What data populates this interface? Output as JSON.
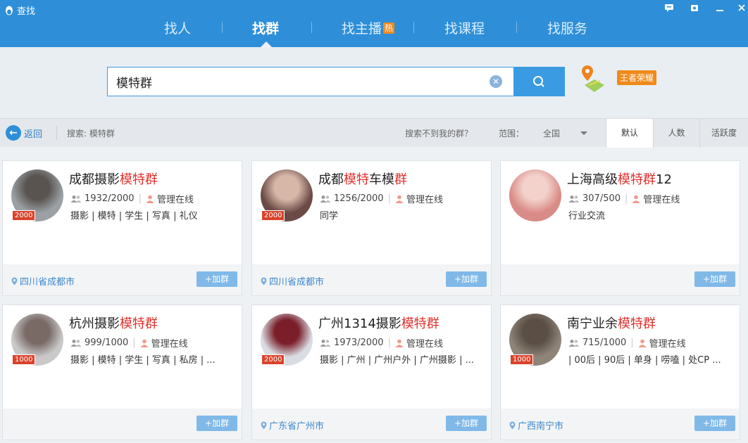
{
  "window": {
    "title": "查找",
    "controls": [
      "feedback-icon",
      "skin-icon",
      "minimize-icon",
      "close-icon"
    ]
  },
  "nav": {
    "items": [
      {
        "label": "找人"
      },
      {
        "label": "找群"
      },
      {
        "label": "找主播",
        "badge": "热"
      },
      {
        "label": "找课程"
      },
      {
        "label": "找服务"
      }
    ],
    "active_index": 1
  },
  "search": {
    "value": "模特群",
    "location_badge": "王者荣耀"
  },
  "toolbar": {
    "back_label": "返回",
    "crumb": "搜索: 模特群",
    "cant_find": "搜索不到我的群？",
    "range_label": "范围：",
    "range_value": "全国",
    "sort_tabs": [
      "默认",
      "人数",
      "活跃度"
    ],
    "active_sort": 0
  },
  "cards": [
    {
      "name_pre": "成都摄影",
      "name_hl": "模特群",
      "name_post": "",
      "members": "1932/2000",
      "admin": "管理在线",
      "tags": "摄影 | 模特 | 学生 | 写真 | 礼仪",
      "location": "四川省成都市",
      "cap": "2000",
      "join": "+加群"
    },
    {
      "name_pre": "成都",
      "name_hl": "模特",
      "name_mid": "车模",
      "name_hl2": "群",
      "name_post": "",
      "members": "1256/2000",
      "admin": "管理在线",
      "tags": "同学",
      "location": "四川省成都市",
      "cap": "2000",
      "join": "+加群"
    },
    {
      "name_pre": "上海高级",
      "name_hl": "模特群",
      "name_post": "12",
      "members": "307/500",
      "admin": "管理在线",
      "tags": "行业交流",
      "location": "",
      "cap": "",
      "join": "+加群"
    },
    {
      "name_pre": "杭州摄影",
      "name_hl": "模特群",
      "name_post": "",
      "members": "999/1000",
      "admin": "管理在线",
      "tags": "摄影 | 模特 | 学生 | 写真 | 私房 | ...",
      "location": "",
      "cap": "1000",
      "join": "+加群"
    },
    {
      "name_pre": "广州1314摄影",
      "name_hl": "模特群",
      "name_post": "",
      "members": "1973/2000",
      "admin": "管理在线",
      "tags": "摄影 | 广州 | 广州户外 | 广州摄影 | ...",
      "location": "广东省广州市",
      "cap": "2000",
      "join": "+加群"
    },
    {
      "name_pre": "南宁业余",
      "name_hl": "模特群",
      "name_post": "",
      "members": "715/1000",
      "admin": "管理在线",
      "tags": "| 00后 | 90后 | 单身 | 唠嗑 | 处CP ...",
      "location": "广西南宁市",
      "cap": "1000",
      "join": "+加群"
    }
  ],
  "colors": {
    "brand": "#2e8fd8",
    "highlight": "#e0302c",
    "join_button": "#80b9e8",
    "cap_badge": "#d9432b"
  }
}
